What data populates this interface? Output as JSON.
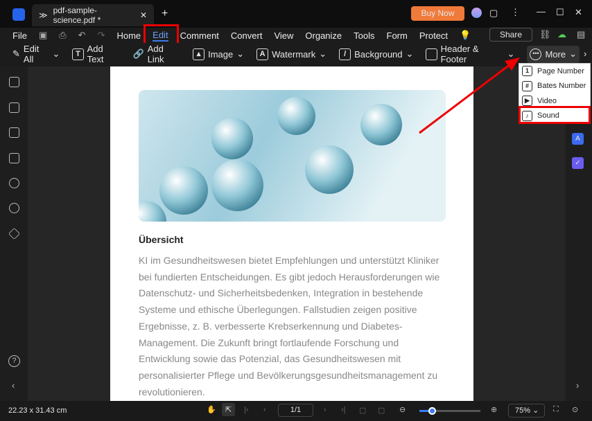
{
  "titlebar": {
    "tab_title": "pdf-sample-science.pdf *",
    "buy_now": "Buy Now"
  },
  "menu": [
    "File",
    "Home",
    "Edit",
    "Comment",
    "Convert",
    "View",
    "Organize",
    "Tools",
    "Form",
    "Protect"
  ],
  "share": "Share",
  "toolbar": [
    "Edit All",
    "Add Text",
    "Add Link",
    "Image",
    "Watermark",
    "Background",
    "Header & Footer",
    "More"
  ],
  "dropdown": [
    "Page Number",
    "Bates Number",
    "Video",
    "Sound"
  ],
  "document": {
    "heading": "Übersicht",
    "body": "KI im Gesundheitswesen bietet Empfehlungen und unterstützt Kliniker bei fundierten Entscheidungen.   Es gibt jedoch Herausforderungen wie Datenschutz- und Sicherheitsbedenken, Integration in bestehende Systeme und ethische Überlegungen. Fallstudien zeigen positive Ergebnisse, z. B.   verbesserte Krebserkennung und Diabetes-Management. Die Zukunft bringt fortlaufende Forschung   und Entwicklung sowie das Potenzial, das Gesundheitswesen mit personalisierter Pflege und Bevölkerungsgesundheitsmanagement zu revolutionieren."
  },
  "status": {
    "size": "22.23 x 31.43 cm",
    "page": "1/1",
    "zoom": "75%",
    "zoom_slider": 0.2
  },
  "colors": {
    "accent": "#3d7bf0",
    "buy": "#f07a3a",
    "highlight": "#e00000"
  }
}
